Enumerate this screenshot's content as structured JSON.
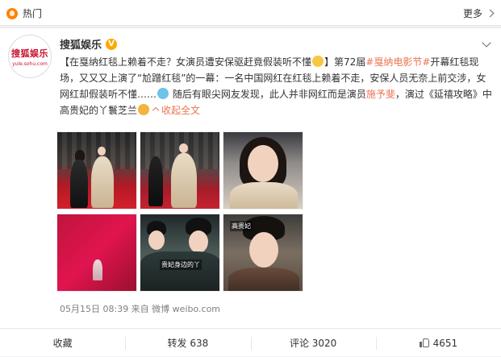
{
  "topbar": {
    "title": "热门",
    "more": "更多"
  },
  "account": {
    "name": "搜狐娱乐",
    "avatar_line1": "搜狐娱乐",
    "avatar_line2": "yule.sohu.com"
  },
  "post": {
    "t1": "【在戛纳红毯上赖着不走？女演员遭安保驱赶竟假装听不懂",
    "t2": "】第72届",
    "t3": "#戛纳电影节#",
    "t4": "开幕红毯现场，又又又上演了“尬蹭红毯”的一幕：一名中国网红在红毯上赖着不走，安保人员无奈上前交涉，女网红却假装听不懂……",
    "t5": " 随后有眼尖网友发现，此人并非网红而是演员",
    "t6": "施予斐",
    "t7": "，演过《延禧攻略》中高贵妃的丫鬟芝兰",
    "collapse": "收起全文"
  },
  "photos": {
    "p5_caption": "贵妃身边的丫",
    "p6_caption": "高贵妃"
  },
  "meta": "05月15日 08:39 来自 微博 weibo.com",
  "actions": {
    "favorite": "收藏",
    "repost": "转发 638",
    "comment": "评论 3020",
    "like": "4651"
  },
  "colors": {
    "link": "#eb7350",
    "verified": "#ffa800",
    "fire": "#ff8200"
  }
}
